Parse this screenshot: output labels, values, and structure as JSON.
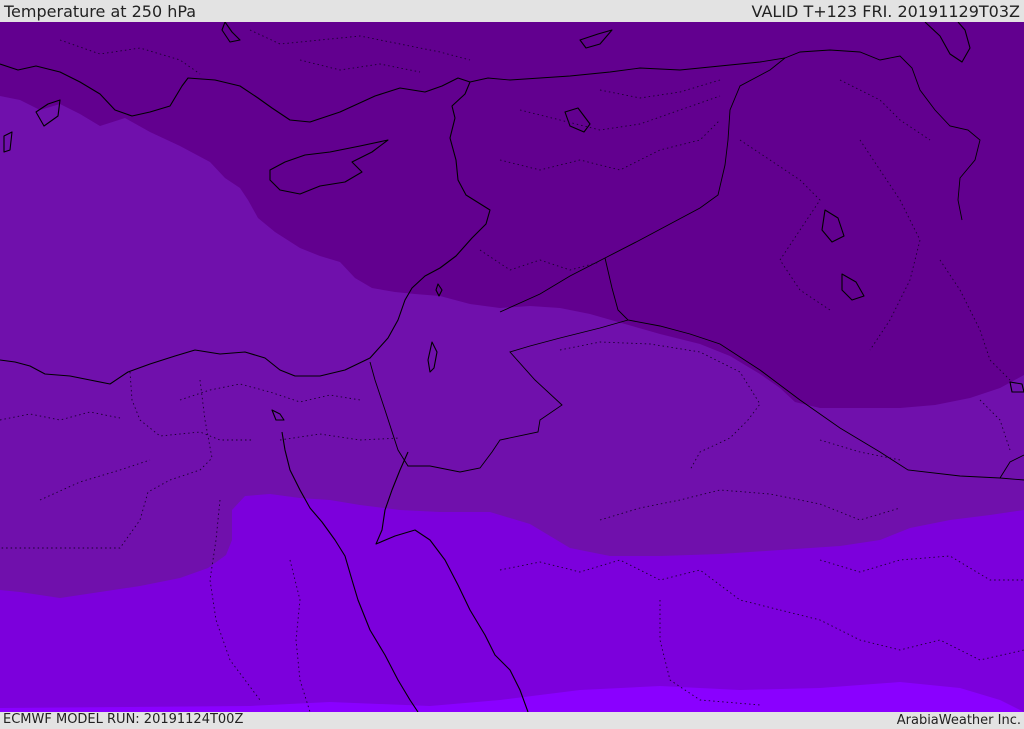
{
  "header": {
    "title": "Temperature at 250 hPa",
    "valid_time": "VALID T+123 FRI. 20191129T03Z"
  },
  "footer": {
    "model_run": "ECMWF MODEL RUN: 20191124T00Z",
    "provider": "ArabiaWeather Inc."
  },
  "map": {
    "field": "temperature_250hPa",
    "colors": {
      "coldest": "#62008f",
      "cold": "#7010ac",
      "mid": "#7c00dc",
      "warm": "#8a00ff",
      "coastline": "#000000",
      "border": "#000000"
    }
  }
}
